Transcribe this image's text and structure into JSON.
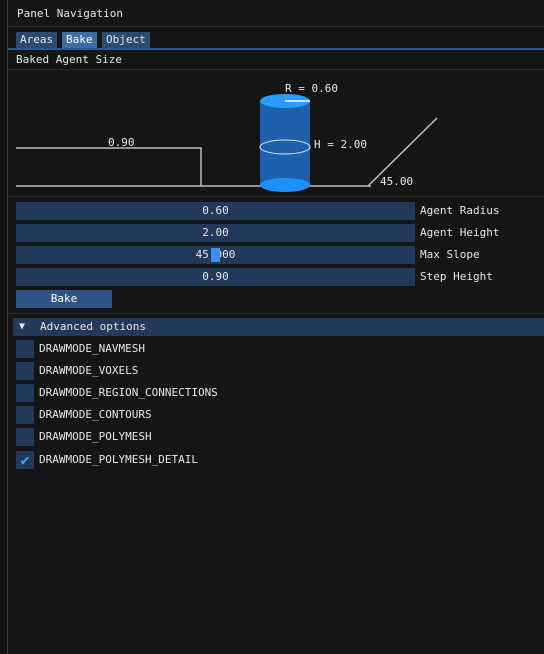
{
  "window": {
    "title": "Panel Navigation"
  },
  "tabs": [
    {
      "label": "Areas",
      "active": false
    },
    {
      "label": "Bake",
      "active": true
    },
    {
      "label": "Object",
      "active": false
    }
  ],
  "section_label": "Baked Agent Size",
  "diagram": {
    "radius_label": "R = 0.60",
    "height_label": "H = 2.00",
    "step_label": "0.90",
    "slope_label": "45.00"
  },
  "fields": [
    {
      "value": "0.60",
      "label": "Agent Radius"
    },
    {
      "value": "2.00",
      "label": "Agent Height"
    },
    {
      "value": "45.000",
      "label": "Max Slope",
      "slider_fraction": 0.5
    },
    {
      "value": "0.90",
      "label": "Step Height"
    }
  ],
  "bake_button": "Bake",
  "advanced": {
    "header": "Advanced options",
    "options": [
      {
        "label": "DRAWMODE_NAVMESH",
        "checked": false
      },
      {
        "label": "DRAWMODE_VOXELS",
        "checked": false
      },
      {
        "label": "DRAWMODE_REGION_CONNECTIONS",
        "checked": false
      },
      {
        "label": "DRAWMODE_CONTOURS",
        "checked": false
      },
      {
        "label": "DRAWMODE_POLYMESH",
        "checked": false
      },
      {
        "label": "DRAWMODE_POLYMESH_DETAIL",
        "checked": true
      }
    ]
  },
  "colors": {
    "accent": "#3d8fe8",
    "frame": "#213a5c",
    "header": "#243a5c"
  }
}
